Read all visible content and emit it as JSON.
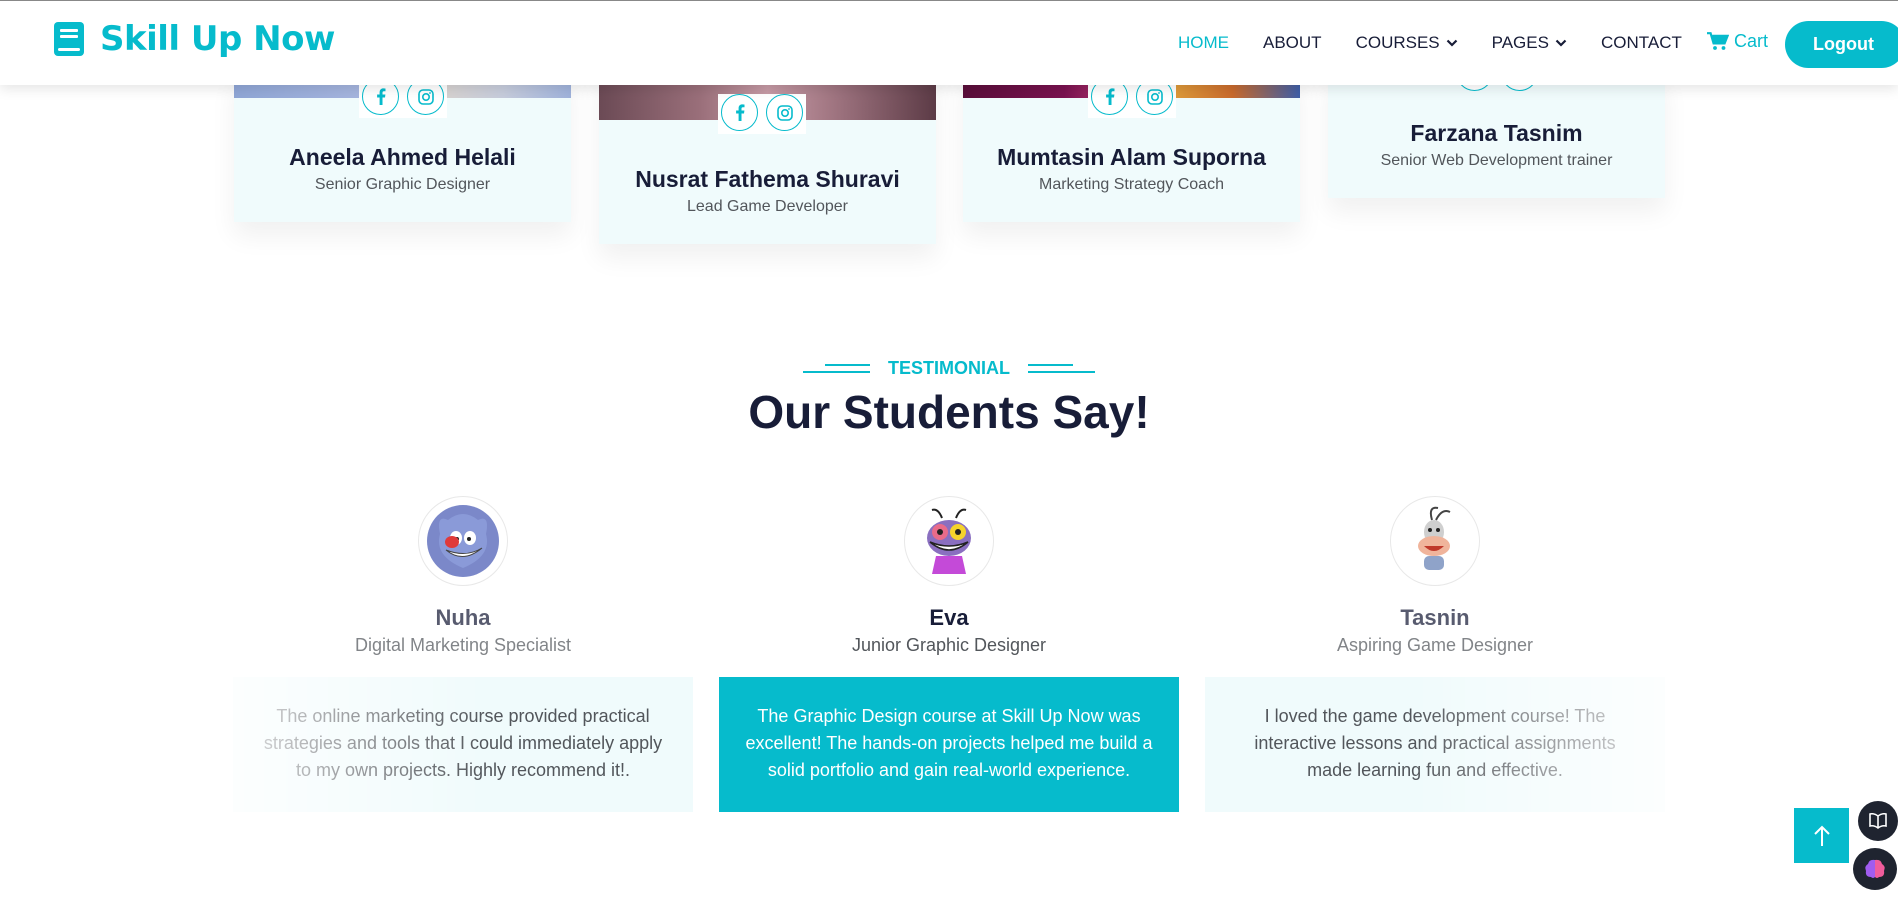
{
  "brand": {
    "name": "Skill Up Now",
    "icon": "book-icon"
  },
  "nav": {
    "items": [
      {
        "label": "HOME",
        "active": true
      },
      {
        "label": "ABOUT"
      },
      {
        "label": "COURSES",
        "dropdown": true
      },
      {
        "label": "PAGES",
        "dropdown": true
      },
      {
        "label": "CONTACT"
      }
    ],
    "cart_label": "Cart",
    "logout_label": "Logout"
  },
  "team": [
    {
      "name": "Aneela Ahmed Helali",
      "role": "Senior Graphic Designer",
      "socials": [
        "facebook-icon",
        "instagram-icon"
      ]
    },
    {
      "name": "Nusrat Fathema Shuravi",
      "role": "Lead Game Developer",
      "socials": [
        "facebook-icon",
        "instagram-icon"
      ]
    },
    {
      "name": "Mumtasin Alam Suporna",
      "role": "Marketing Strategy Coach",
      "socials": [
        "facebook-icon",
        "instagram-icon"
      ]
    },
    {
      "name": "Farzana Tasnim",
      "role": "Senior Web Development trainer",
      "socials": [
        "facebook-icon",
        "instagram-icon"
      ]
    }
  ],
  "testimonial": {
    "tag": "TESTIMONIAL",
    "title": "Our Students Say!",
    "items": [
      {
        "name": "Nuha",
        "role": "Digital Marketing Specialist",
        "text": "The online marketing course provided practical strategies and tools that I could immediately apply to my own projects. Highly recommend it!.",
        "avatar": "cartoon-cat-avatar"
      },
      {
        "name": "Eva",
        "role": "Junior Graphic Designer",
        "text": "The Graphic Design course at Skill Up Now was excellent! The hands-on projects helped me build a solid portfolio and gain real-world experience.",
        "avatar": "cartoon-bug-avatar",
        "active": true
      },
      {
        "name": "Tasnin",
        "role": "Aspiring Game Designer",
        "text": "I loved the game development course! The interactive lessons and practical assignments made learning fun and effective.",
        "avatar": "cartoon-cockroach-avatar"
      }
    ]
  },
  "colors": {
    "primary": "#06bbcc",
    "dark": "#181d38",
    "light_bg": "#f0fbfc",
    "text_muted": "#52565b"
  }
}
